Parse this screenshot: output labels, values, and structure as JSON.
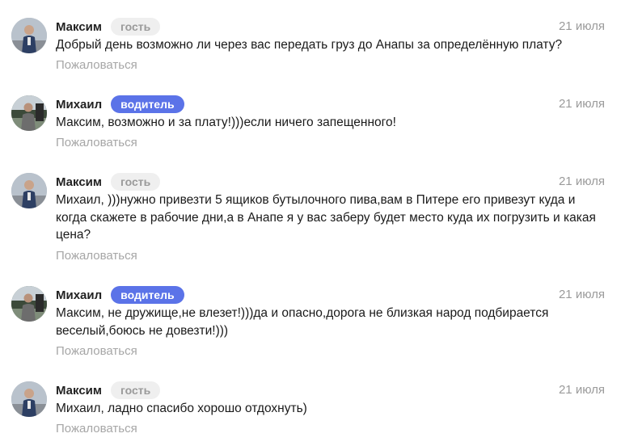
{
  "comments": [
    {
      "author": "Максим",
      "role": "гость",
      "role_type": "guest",
      "date": "21 июля",
      "text": "Добрый день возможно ли через вас передать груз до Анапы за определённую плату?",
      "report": "Пожаловаться"
    },
    {
      "author": "Михаил",
      "role": "водитель",
      "role_type": "driver",
      "date": "21 июля",
      "text": "Максим, возможно и за плату!)))если ничего запещенного!",
      "report": "Пожаловаться"
    },
    {
      "author": "Максим",
      "role": "гость",
      "role_type": "guest",
      "date": "21 июля",
      "text": "Михаил, )))нужно привезти 5 ящиков бутылочного пива,вам в Питере его привезут куда и когда скажете в рабочие дни,а в Анапе я у вас заберу будет место куда их погрузить и какая цена?",
      "report": "Пожаловаться"
    },
    {
      "author": "Михаил",
      "role": "водитель",
      "role_type": "driver",
      "date": "21 июля",
      "text": "Максим, не дружище,не влезет!)))да и опасно,дорога не близкая народ подбирается веселый,боюсь не довезти!)))",
      "report": "Пожаловаться"
    },
    {
      "author": "Максим",
      "role": "гость",
      "role_type": "guest",
      "date": "21 июля",
      "text": "Михаил, ладно спасибо хорошо отдохнуть)",
      "report": "Пожаловаться"
    }
  ],
  "colors": {
    "driver_badge": "#5b73e8",
    "guest_badge": "#efefef",
    "muted_text": "#9a9a9a"
  }
}
